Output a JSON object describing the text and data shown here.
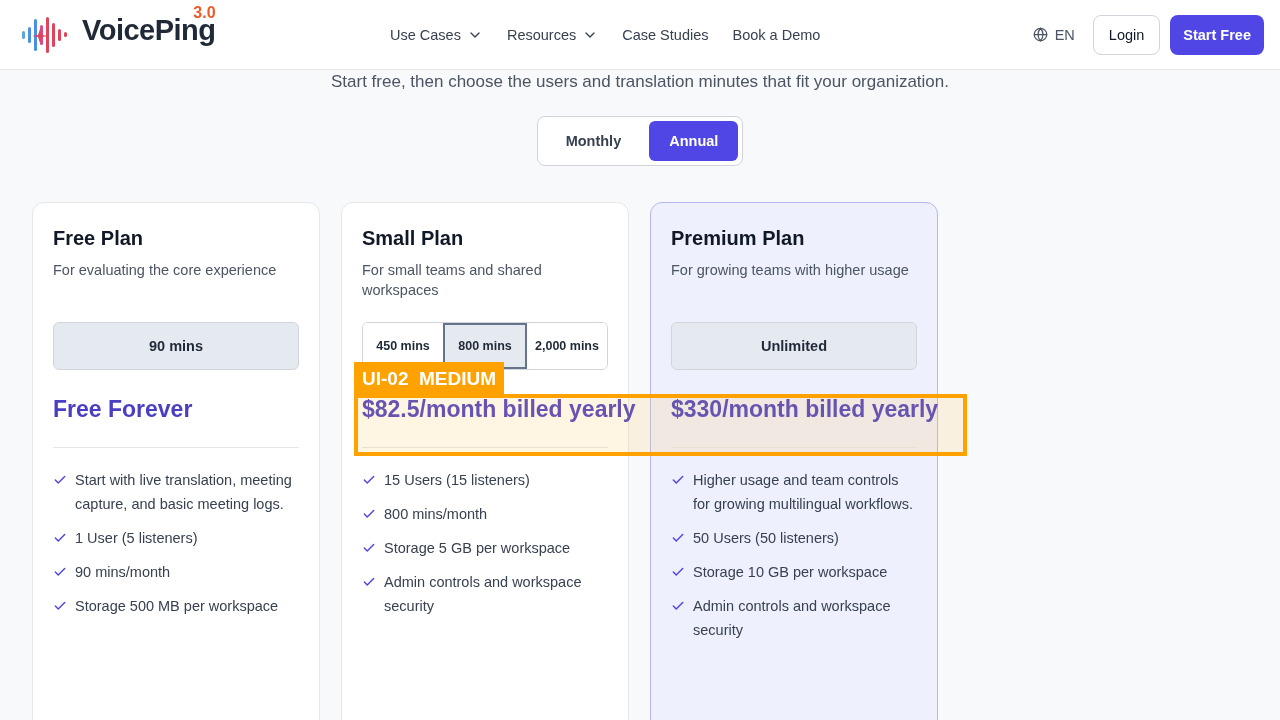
{
  "header": {
    "logo": {
      "name": "VoicePing",
      "version": "3.0"
    },
    "nav": [
      {
        "label": "Use Cases",
        "dropdown": true
      },
      {
        "label": "Resources",
        "dropdown": true
      },
      {
        "label": "Case Studies",
        "dropdown": false
      },
      {
        "label": "Book a Demo",
        "dropdown": false
      }
    ],
    "language": "EN",
    "login": "Login",
    "cta": "Start Free"
  },
  "subtitle": "Start free, then choose the users and translation minutes that fit your organization.",
  "billing_toggle": [
    {
      "label": "Monthly",
      "selected": false
    },
    {
      "label": "Annual",
      "selected": true
    }
  ],
  "plans": [
    {
      "title": "Free Plan",
      "description": "For evaluating the core experience",
      "highlighted": false,
      "kind": "single",
      "options": [
        {
          "label": "90 mins",
          "selected": true
        }
      ],
      "price": "Free Forever",
      "features": [
        "Start with live translation, meeting capture, and basic meeting logs.",
        "1 User (5 listeners)",
        "90 mins/month",
        "Storage 500 MB per workspace"
      ]
    },
    {
      "title": "Small Plan",
      "description": "For small teams and shared workspaces",
      "highlighted": false,
      "kind": "segmented",
      "options": [
        {
          "label": "450 mins",
          "selected": false
        },
        {
          "label": "800 mins",
          "selected": true
        },
        {
          "label": "2,000 mins",
          "selected": false
        }
      ],
      "price": "$82.5/month billed yearly",
      "features": [
        "15 Users (15 listeners)",
        "800 mins/month",
        "Storage 5 GB per workspace",
        "Admin controls and workspace security"
      ]
    },
    {
      "title": "Premium Plan",
      "description": "For growing teams with higher usage",
      "highlighted": true,
      "kind": "single",
      "options": [
        {
          "label": "Unlimited",
          "selected": true
        }
      ],
      "price": "$330/month billed yearly",
      "features": [
        "Higher usage and team controls for growing multilingual workflows.",
        "50 Users (50 listeners)",
        "Storage 10 GB per workspace",
        "Admin controls and workspace security"
      ]
    }
  ],
  "annotation": {
    "id": "UI-02",
    "severity": "MEDIUM"
  }
}
